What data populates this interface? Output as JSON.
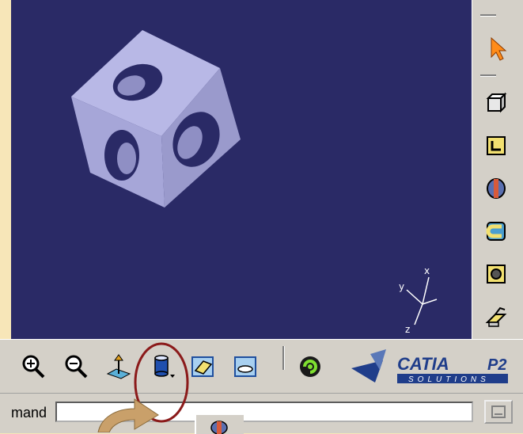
{
  "viewport": {
    "background": "#2a2a66",
    "axis_labels": {
      "x": "x",
      "y": "y",
      "z": "z"
    }
  },
  "right_toolbar": {
    "buttons": [
      "select-icon",
      "pad-icon",
      "pocket-icon",
      "shaft-icon",
      "groove-icon",
      "hole-icon",
      "rib-icon"
    ]
  },
  "bottom_toolbar": {
    "buttons": [
      "zoom-in-icon",
      "zoom-out-icon",
      "normal-view-icon",
      "cylinder-view-icon",
      "shading-icon",
      "hide-show-icon",
      "swap-icon"
    ]
  },
  "logo": {
    "brand": "CATIA",
    "tier": "P2",
    "subtitle": "SOLUTIONS"
  },
  "command": {
    "label": "mand",
    "value": ""
  },
  "colors": {
    "highlight": "#8b1a1a",
    "arrow": "#c9a06a",
    "accent": "#1f3d8a"
  }
}
